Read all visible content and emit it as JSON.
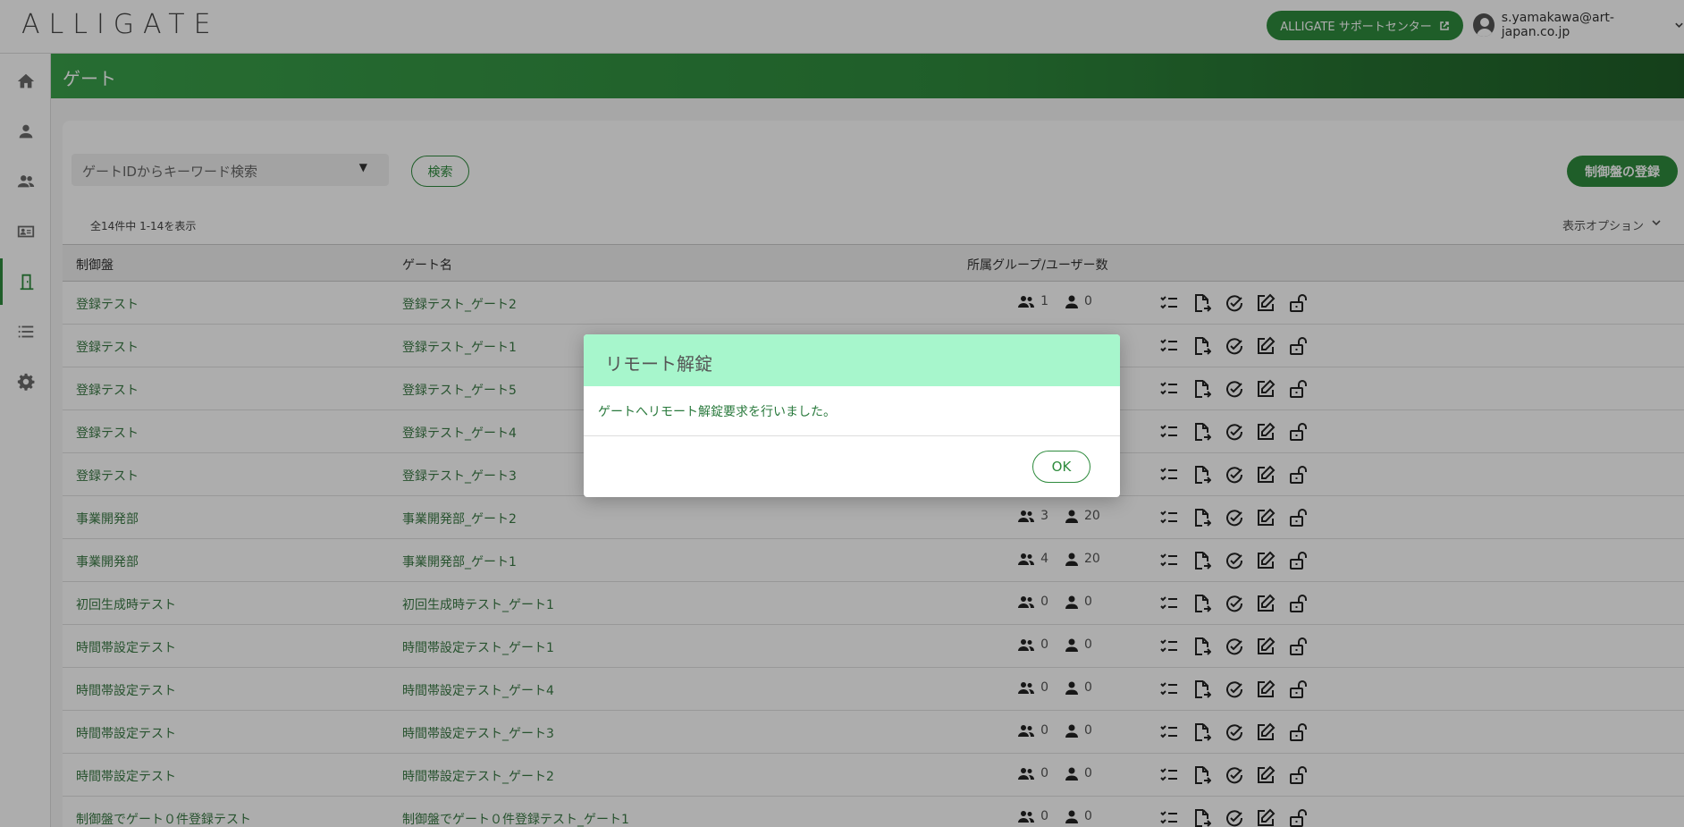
{
  "header": {
    "logo": "ALLIGATE",
    "support_label": "ALLIGATE サポートセンター",
    "user_email": "s.yamakawa@art-japan.co.jp"
  },
  "sidebar": {
    "items": [
      {
        "name": "home",
        "icon": "home-icon"
      },
      {
        "name": "user",
        "icon": "person-icon"
      },
      {
        "name": "groups",
        "icon": "people-icon"
      },
      {
        "name": "cards",
        "icon": "id-card-icon"
      },
      {
        "name": "gates",
        "icon": "door-icon",
        "active": true
      },
      {
        "name": "logs",
        "icon": "list-icon"
      },
      {
        "name": "settings",
        "icon": "gear-icon"
      }
    ]
  },
  "page": {
    "title": "ゲート"
  },
  "toolbar": {
    "search_placeholder": "ゲートIDからキーワード検索",
    "search_label": "検索",
    "register_label": "制御盤の登録",
    "count_text": "全14件中 1-14を表示",
    "options_label": "表示オプション"
  },
  "table": {
    "headers": {
      "panel": "制御盤",
      "gate": "ゲート名",
      "counts": "所属グループ/ユーザー数"
    },
    "rows": [
      {
        "panel": "登録テスト",
        "gate": "登録テスト_ゲート2",
        "groups": "1",
        "users": "0"
      },
      {
        "panel": "登録テスト",
        "gate": "登録テスト_ゲート1",
        "groups": "",
        "users": ""
      },
      {
        "panel": "登録テスト",
        "gate": "登録テスト_ゲート5",
        "groups": "",
        "users": ""
      },
      {
        "panel": "登録テスト",
        "gate": "登録テスト_ゲート4",
        "groups": "",
        "users": ""
      },
      {
        "panel": "登録テスト",
        "gate": "登録テスト_ゲート3",
        "groups": "",
        "users": ""
      },
      {
        "panel": "事業開発部",
        "gate": "事業開発部_ゲート2",
        "groups": "3",
        "users": "20"
      },
      {
        "panel": "事業開発部",
        "gate": "事業開発部_ゲート1",
        "groups": "4",
        "users": "20"
      },
      {
        "panel": "初回生成時テスト",
        "gate": "初回生成時テスト_ゲート1",
        "groups": "0",
        "users": "0"
      },
      {
        "panel": "時間帯設定テスト",
        "gate": "時間帯設定テスト_ゲート1",
        "groups": "0",
        "users": "0"
      },
      {
        "panel": "時間帯設定テスト",
        "gate": "時間帯設定テスト_ゲート4",
        "groups": "0",
        "users": "0"
      },
      {
        "panel": "時間帯設定テスト",
        "gate": "時間帯設定テスト_ゲート3",
        "groups": "0",
        "users": "0"
      },
      {
        "panel": "時間帯設定テスト",
        "gate": "時間帯設定テスト_ゲート2",
        "groups": "0",
        "users": "0"
      },
      {
        "panel": "制御盤でゲート０件登録テスト",
        "gate": "制御盤でゲート０件登録テスト_ゲート1",
        "groups": "0",
        "users": "0"
      }
    ]
  },
  "dialog": {
    "title": "リモート解錠",
    "message": "ゲートへリモート解錠要求を行いました。",
    "ok_label": "OK"
  },
  "colors": {
    "brand_green": "#2e8b3d",
    "dialog_header": "#a7f6cc"
  }
}
